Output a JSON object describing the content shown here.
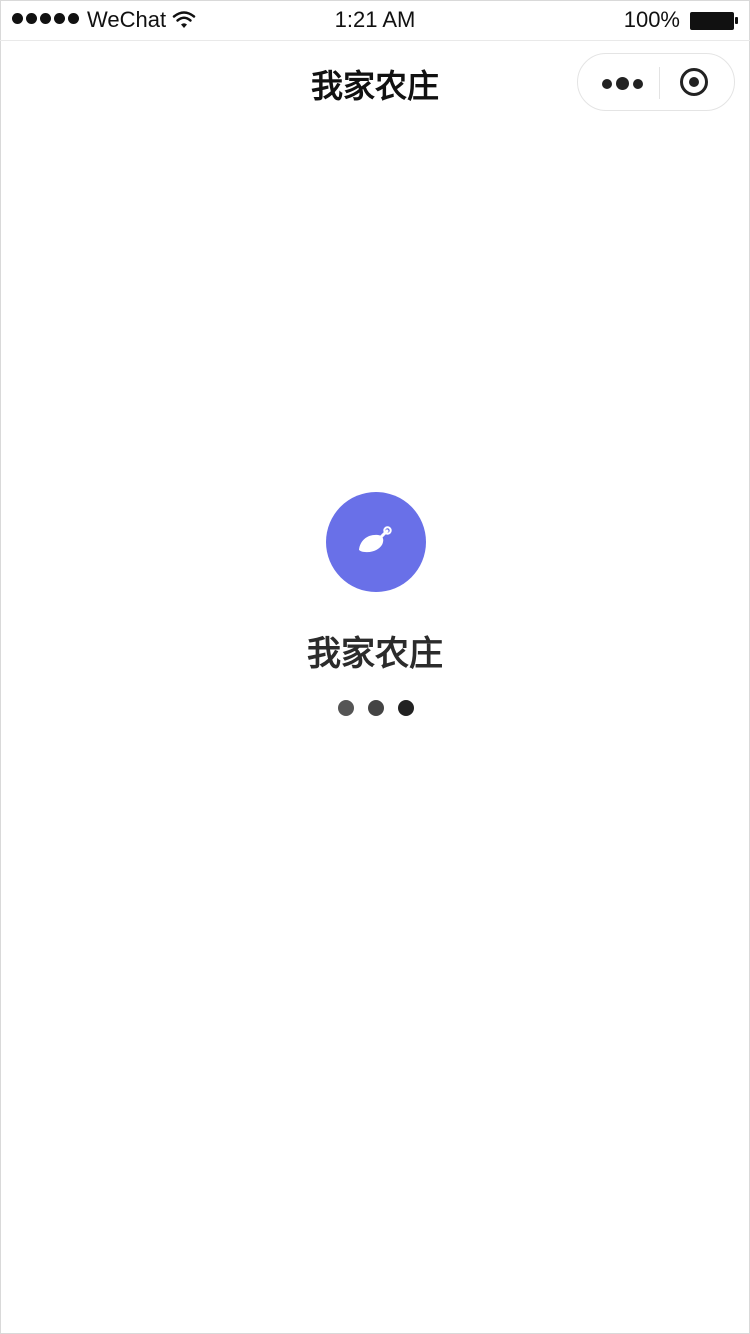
{
  "status_bar": {
    "carrier": "WeChat",
    "time": "1:21 AM",
    "battery_percent": "100%",
    "signal_icon": "signal-dots-icon",
    "wifi_icon": "wifi-icon",
    "battery_icon": "battery-icon",
    "battery_level": 1.0
  },
  "nav_bar": {
    "title": "我家农庄",
    "more_icon": "more-dots-icon",
    "close_icon": "close-circle-icon"
  },
  "splash": {
    "app_name": "我家农庄",
    "logo_icon": "leaf-icon",
    "logo_color": "#6970e8",
    "loading_icon": "loading-dots-icon"
  }
}
